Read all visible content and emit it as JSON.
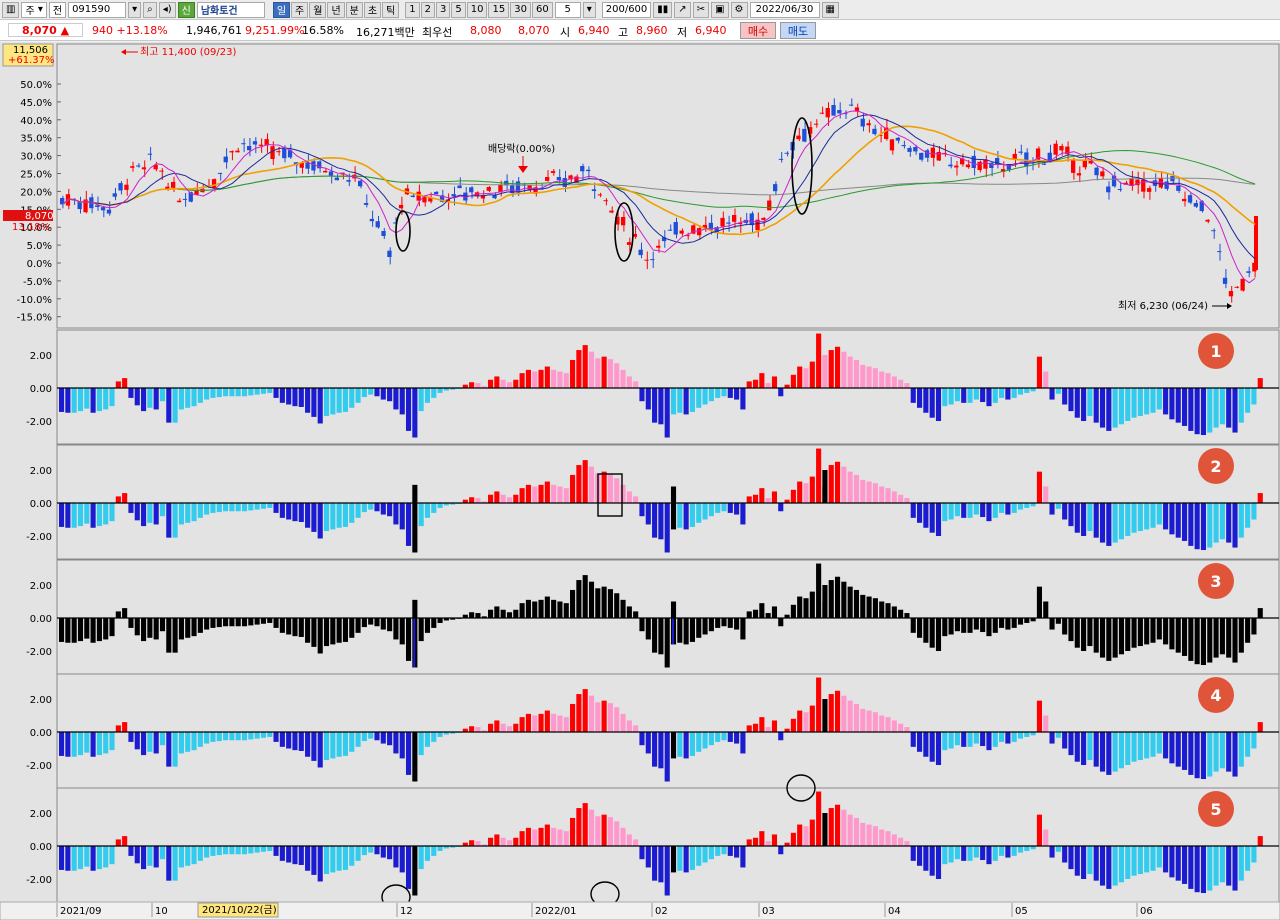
{
  "toolbar": {
    "market": "주",
    "prefix": "전",
    "code": "091590",
    "name_badge": "신",
    "name": "남화토건",
    "periods": [
      "일",
      "주",
      "월",
      "년",
      "분",
      "초",
      "틱"
    ],
    "selected_period": "일",
    "intervals": [
      "1",
      "2",
      "3",
      "5",
      "10",
      "15",
      "30",
      "60"
    ],
    "interval_select": "5",
    "count": "200",
    "count_max": "600",
    "date": "2022/06/30"
  },
  "quote": {
    "price": "8,070 ▲",
    "change": "940 +13.18%",
    "volume": "1,946,761",
    "volume_ratio": "9,251.99%",
    "turnover": "16.58%",
    "amount": "16,271백만",
    "best_ask_label": "최우선",
    "best_ask": "8,080",
    "best_bid": "8,070",
    "open_label": "시",
    "open": "6,940",
    "high_label": "고",
    "high": "8,960",
    "low_label": "저",
    "low": "6,940",
    "buy_btn": "매수",
    "sell_btn": "매도"
  },
  "colors": {
    "up": "#ff0000",
    "down": "#1f4fd8",
    "pink": "#ff99cc",
    "cyan": "#33ccee",
    "blue": "#1b1bd0",
    "black": "#000000",
    "ma5": "#cc22cc",
    "ma10": "#1a2a9a",
    "ma20": "#f0a000",
    "ma60": "#2a9a2a",
    "ma120": "#888888",
    "badge": "#e0553a"
  },
  "price_chart": {
    "tag_price": "11,506",
    "tag_pct": "+61.37%",
    "current_price": "8,070",
    "current_pct": "13.18%",
    "high_note": "최고 11,400 (09/23)",
    "low_note": "최저 6,230 (06/24)",
    "dividend_note": "배당락(0.00%)",
    "y_ticks": [
      "50.0%",
      "45.0%",
      "40.0%",
      "35.0%",
      "30.0%",
      "25.0%",
      "20.0%",
      "15.0%",
      "10.0%",
      "5.0%",
      "0.0%",
      "-5.0%",
      "-10.0%",
      "-15.0%"
    ]
  },
  "panels": [
    {
      "badge": "1",
      "ticks": [
        "2.00",
        "0.00",
        "-2.00"
      ]
    },
    {
      "badge": "2",
      "ticks": [
        "2.00",
        "0.00",
        "-2.00"
      ]
    },
    {
      "badge": "3",
      "ticks": [
        "2.00",
        "0.00",
        "-2.00"
      ]
    },
    {
      "badge": "4",
      "ticks": [
        "2.00",
        "0.00",
        "-2.00"
      ]
    },
    {
      "badge": "5",
      "ticks": [
        "2.00",
        "0.00",
        "-2.00"
      ]
    }
  ],
  "x_axis": {
    "labels": [
      "2021/09",
      "10",
      "12",
      "2022/01",
      "02",
      "03",
      "04",
      "05",
      "06"
    ],
    "cursor_date": "2021/10/22(금)"
  },
  "chart_data": {
    "type": "bar",
    "histogram": [
      -1.45,
      -1.5,
      -1.5,
      -1.4,
      -1.25,
      -1.5,
      -1.4,
      -1.3,
      -1.1,
      0.4,
      0.6,
      -0.6,
      -1.05,
      -1.4,
      -1.2,
      -1.3,
      -0.8,
      -2.1,
      -2.1,
      -1.3,
      -1.2,
      -1.1,
      -0.9,
      -0.7,
      -0.6,
      -0.55,
      -0.5,
      -0.5,
      -0.5,
      -0.5,
      -0.45,
      -0.4,
      -0.35,
      -0.3,
      -0.6,
      -0.9,
      -1.0,
      -1.1,
      -1.15,
      -1.5,
      -1.75,
      -2.15,
      -1.7,
      -1.6,
      -1.5,
      -1.45,
      -1.2,
      -0.9,
      -0.55,
      -0.4,
      -0.5,
      -0.7,
      -0.8,
      -1.3,
      -1.6,
      -2.6,
      -3.0,
      -1.4,
      -0.9,
      -0.6,
      -0.3,
      -0.15,
      -0.1,
      -0.05,
      0.2,
      0.35,
      0.3,
      0.1,
      0.5,
      0.7,
      0.5,
      0.35,
      0.5,
      0.9,
      1.1,
      1.0,
      1.1,
      1.3,
      1.1,
      1.0,
      0.9,
      1.7,
      2.3,
      2.6,
      2.2,
      1.8,
      1.9,
      1.75,
      1.5,
      1.1,
      0.7,
      0.4,
      -0.8,
      -1.3,
      -2.1,
      -2.2,
      -3.0,
      -1.6,
      -1.5,
      -1.6,
      -1.45,
      -1.2,
      -1.0,
      -0.8,
      -0.6,
      -0.5,
      -0.6,
      -0.7,
      -1.3,
      0.4,
      0.5,
      0.9,
      0.3,
      0.7,
      -0.5,
      0.2,
      0.8,
      1.3,
      1.2,
      1.6,
      3.3,
      2.0,
      2.3,
      2.5,
      2.2,
      1.9,
      1.7,
      1.4,
      1.3,
      1.2,
      1.0,
      0.9,
      0.7,
      0.5,
      0.3,
      -0.9,
      -1.2,
      -1.5,
      -1.8,
      -2.0,
      -1.1,
      -1.0,
      -0.8,
      -0.9,
      -0.9,
      -0.7,
      -0.85,
      -1.1,
      -0.9,
      -0.6,
      -0.7,
      -0.6,
      -0.4,
      -0.3,
      -0.2,
      1.9,
      1.0,
      -0.7,
      -0.35,
      -1.0,
      -1.4,
      -1.8,
      -2.0,
      -1.7,
      -2.1,
      -2.4,
      -2.6,
      -2.4,
      -2.2,
      -2.0,
      -1.8,
      -1.7,
      -1.6,
      -1.5,
      -1.3,
      -1.6,
      -1.9,
      -2.1,
      -2.3,
      -2.6,
      -2.8,
      -2.85,
      -2.7,
      -2.4,
      -2.2,
      -2.4,
      -2.7,
      -2.1,
      -1.5,
      -1.0,
      0.6
    ]
  }
}
